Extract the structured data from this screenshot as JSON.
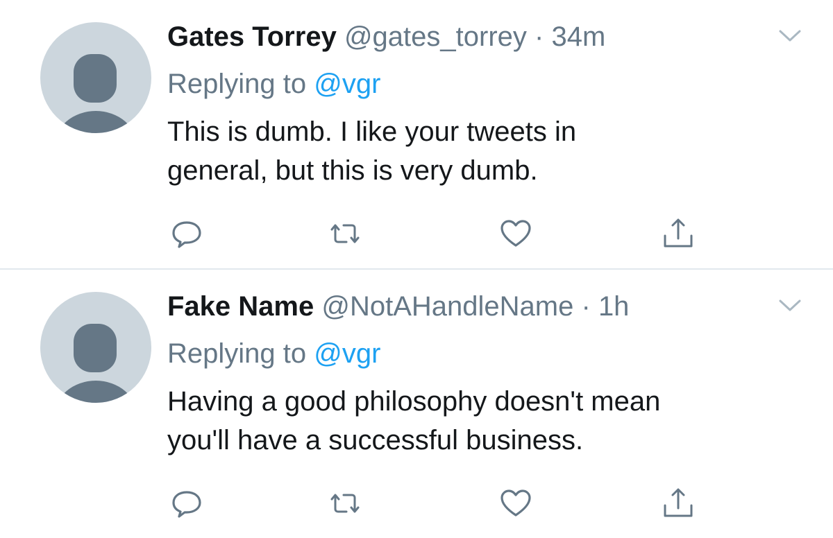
{
  "colors": {
    "text": "#14171a",
    "secondary": "#657786",
    "link": "#1da1f2",
    "avatar_bg": "#ccd6dd",
    "avatar_fg": "#657786",
    "divider": "#e1e8ed"
  },
  "tweets": [
    {
      "name": "Gates Torrey",
      "handle": "@gates_torrey",
      "separator": "·",
      "time": "34m",
      "replying_prefix": "Replying to",
      "replying_to": "@vgr",
      "text_lines": [
        "This is dumb. I like your tweets in",
        "general, but this is very dumb."
      ],
      "icons": {
        "more": "chevron-down-icon",
        "reply": "reply-icon",
        "retweet": "retweet-icon",
        "like": "heart-icon",
        "share": "share-icon"
      }
    },
    {
      "name": "Fake Name",
      "handle": "@NotAHandleName",
      "separator": "·",
      "time": "1h",
      "replying_prefix": "Replying to",
      "replying_to": "@vgr",
      "text_lines": [
        "Having a good philosophy doesn't mean",
        "you'll have a successful business."
      ],
      "icons": {
        "more": "chevron-down-icon",
        "reply": "reply-icon",
        "retweet": "retweet-icon",
        "like": "heart-icon",
        "share": "share-icon"
      }
    }
  ]
}
